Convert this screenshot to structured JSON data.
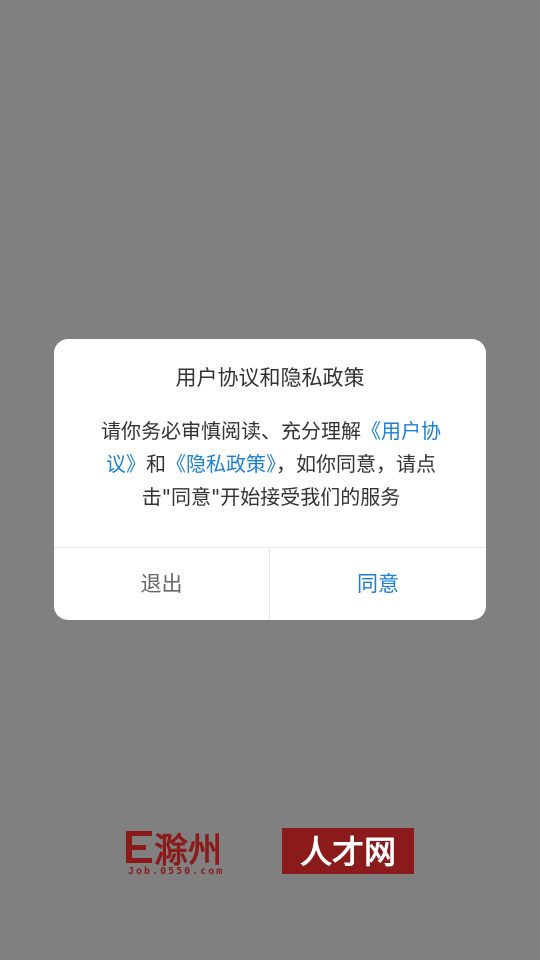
{
  "dialog": {
    "title": "用户协议和隐私政策",
    "body_prefix": "请你务必审慎阅读、充分理解",
    "user_agreement_link": "《用户协议》",
    "body_and": "和",
    "privacy_policy_link": "《隐私政策》",
    "body_suffix": "，如你同意，请点击\"同意\"开始接受我们的服务",
    "exit_label": "退出",
    "agree_label": "同意"
  },
  "brand": {
    "logo_main": "滁州",
    "logo_sub": "人才网",
    "logo_url": "Job.0550.com",
    "color": "#8b1a1a"
  },
  "colors": {
    "accent": "#1a7fd6",
    "overlay": "#808080"
  }
}
